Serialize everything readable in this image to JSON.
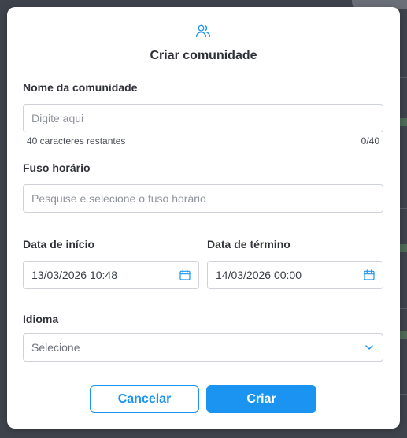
{
  "modal": {
    "title": "Criar comunidade",
    "header_icon": "users-icon"
  },
  "community_name": {
    "label": "Nome da comunidade",
    "placeholder": "Digite aqui",
    "value": "",
    "remaining_text": "40 caracteres restantes",
    "counter": "0/40"
  },
  "timezone": {
    "label": "Fuso horário",
    "placeholder": "Pesquise e selecione o fuso horário",
    "value": ""
  },
  "start_date": {
    "label": "Data de início",
    "value": "13/03/2026 10:48",
    "icon": "calendar-icon"
  },
  "end_date": {
    "label": "Data de término",
    "value": "14/03/2026 00:00",
    "icon": "calendar-icon"
  },
  "language": {
    "label": "Idioma",
    "selected": "Selecione",
    "icon": "chevron-down-icon"
  },
  "actions": {
    "cancel_label": "Cancelar",
    "create_label": "Criar"
  },
  "colors": {
    "accent": "#1a94f0",
    "text": "#2f3138",
    "border": "#cfd2d8",
    "overlay": "#3f434b"
  }
}
